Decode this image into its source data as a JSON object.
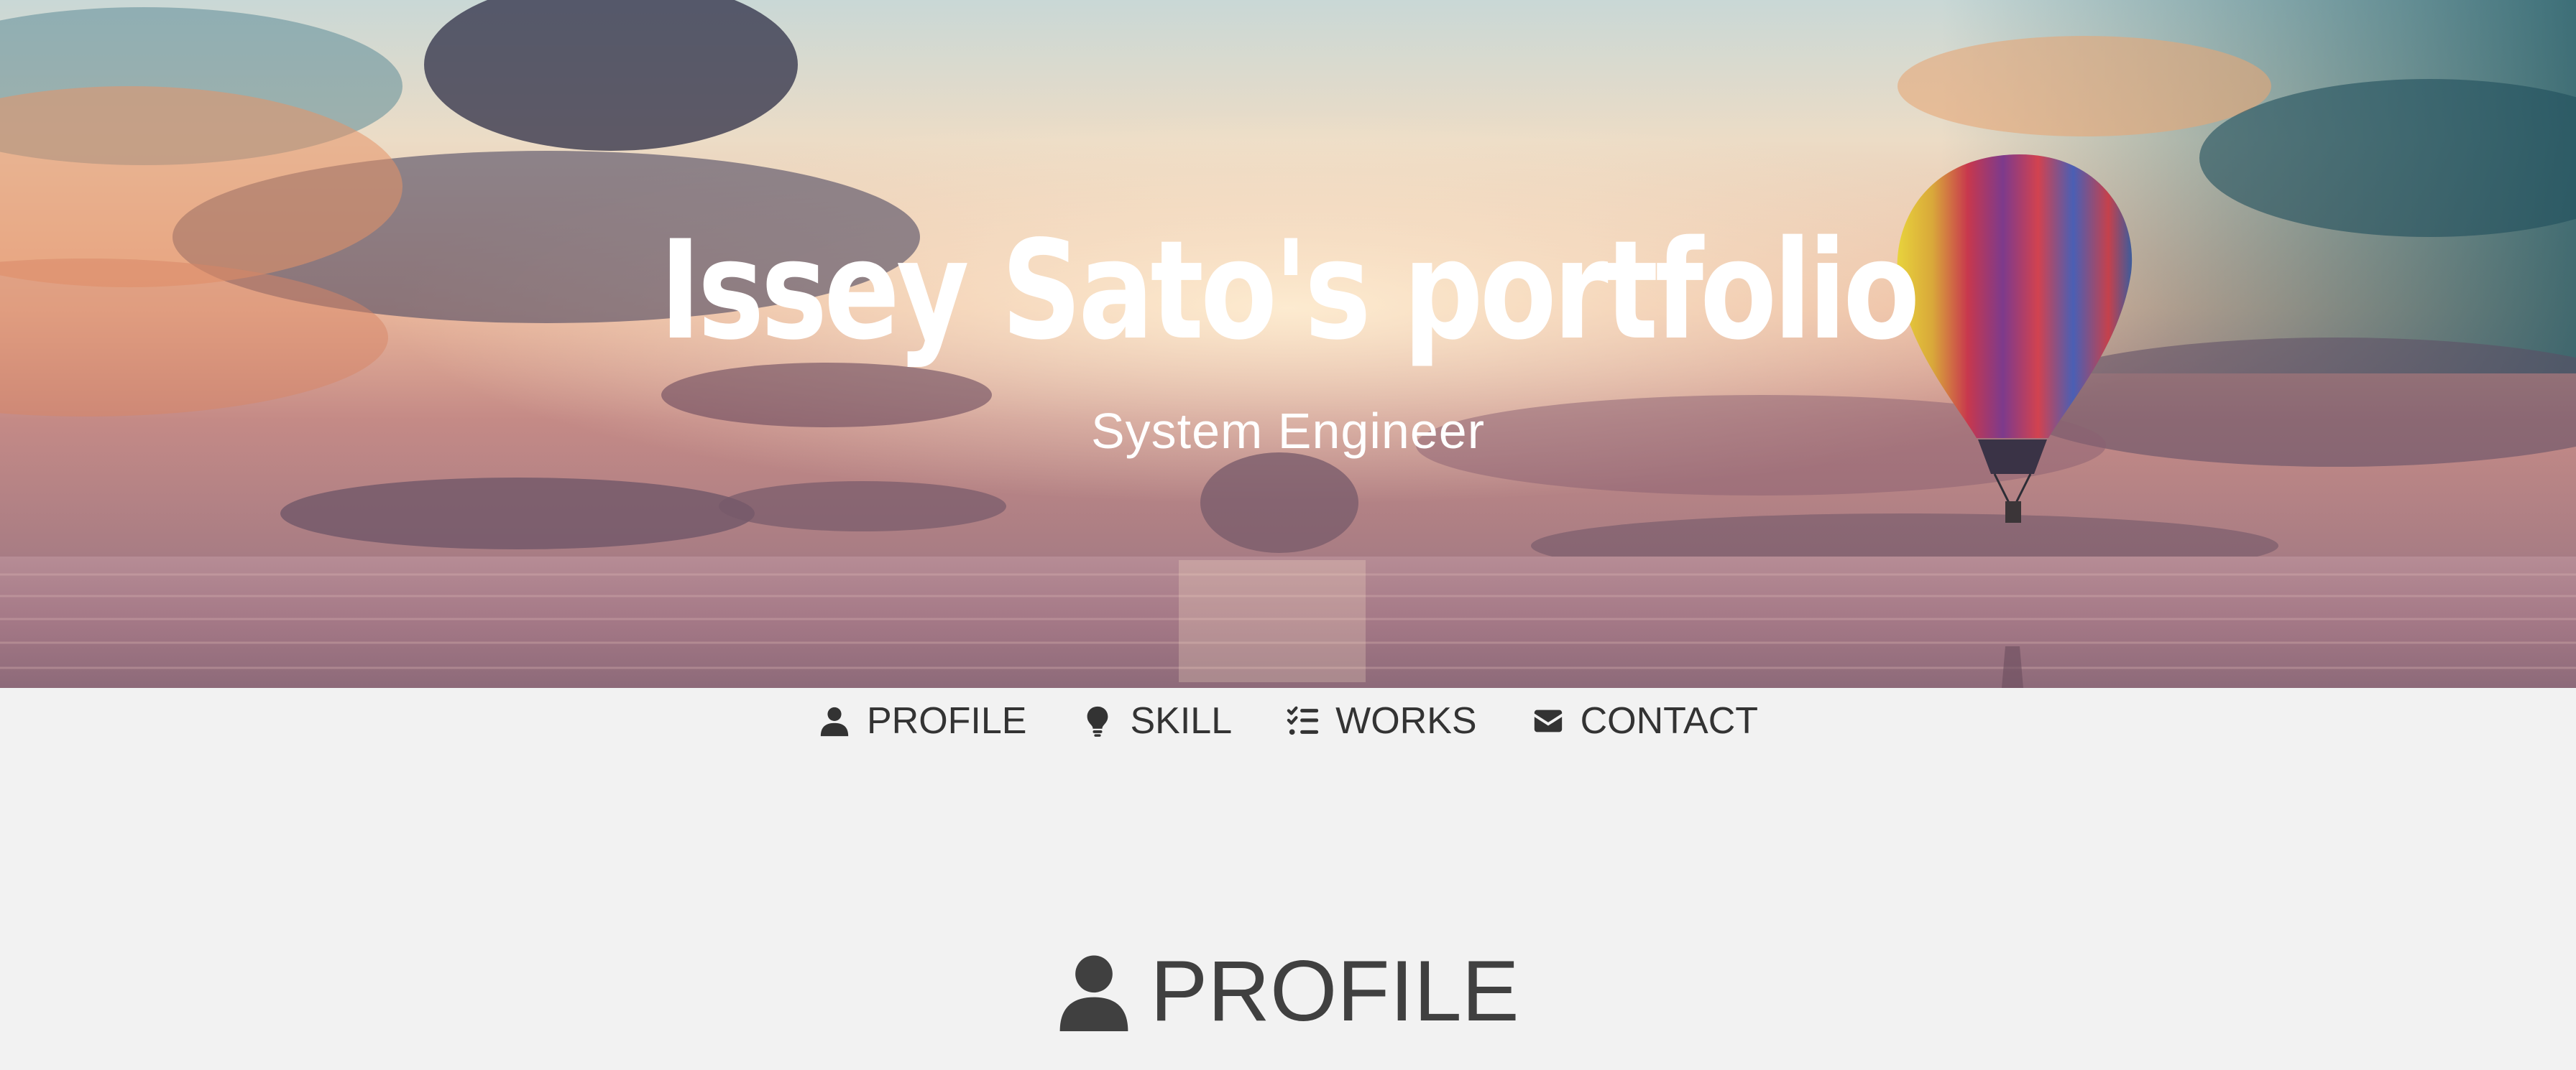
{
  "hero": {
    "title": "Issey Sato's portfolio",
    "subtitle": "System Engineer"
  },
  "nav": {
    "items": [
      {
        "label": "PROFILE",
        "icon": "user-icon"
      },
      {
        "label": "SKILL",
        "icon": "lightbulb-icon"
      },
      {
        "label": "WORKS",
        "icon": "task-list-icon"
      },
      {
        "label": "CONTACT",
        "icon": "envelope-icon"
      }
    ]
  },
  "section": {
    "title": "PROFILE",
    "icon": "user-icon"
  },
  "colors": {
    "text_dark": "#333333",
    "heading": "#404040",
    "page_background": "#f2f2f2",
    "hero_text": "#ffffff"
  }
}
